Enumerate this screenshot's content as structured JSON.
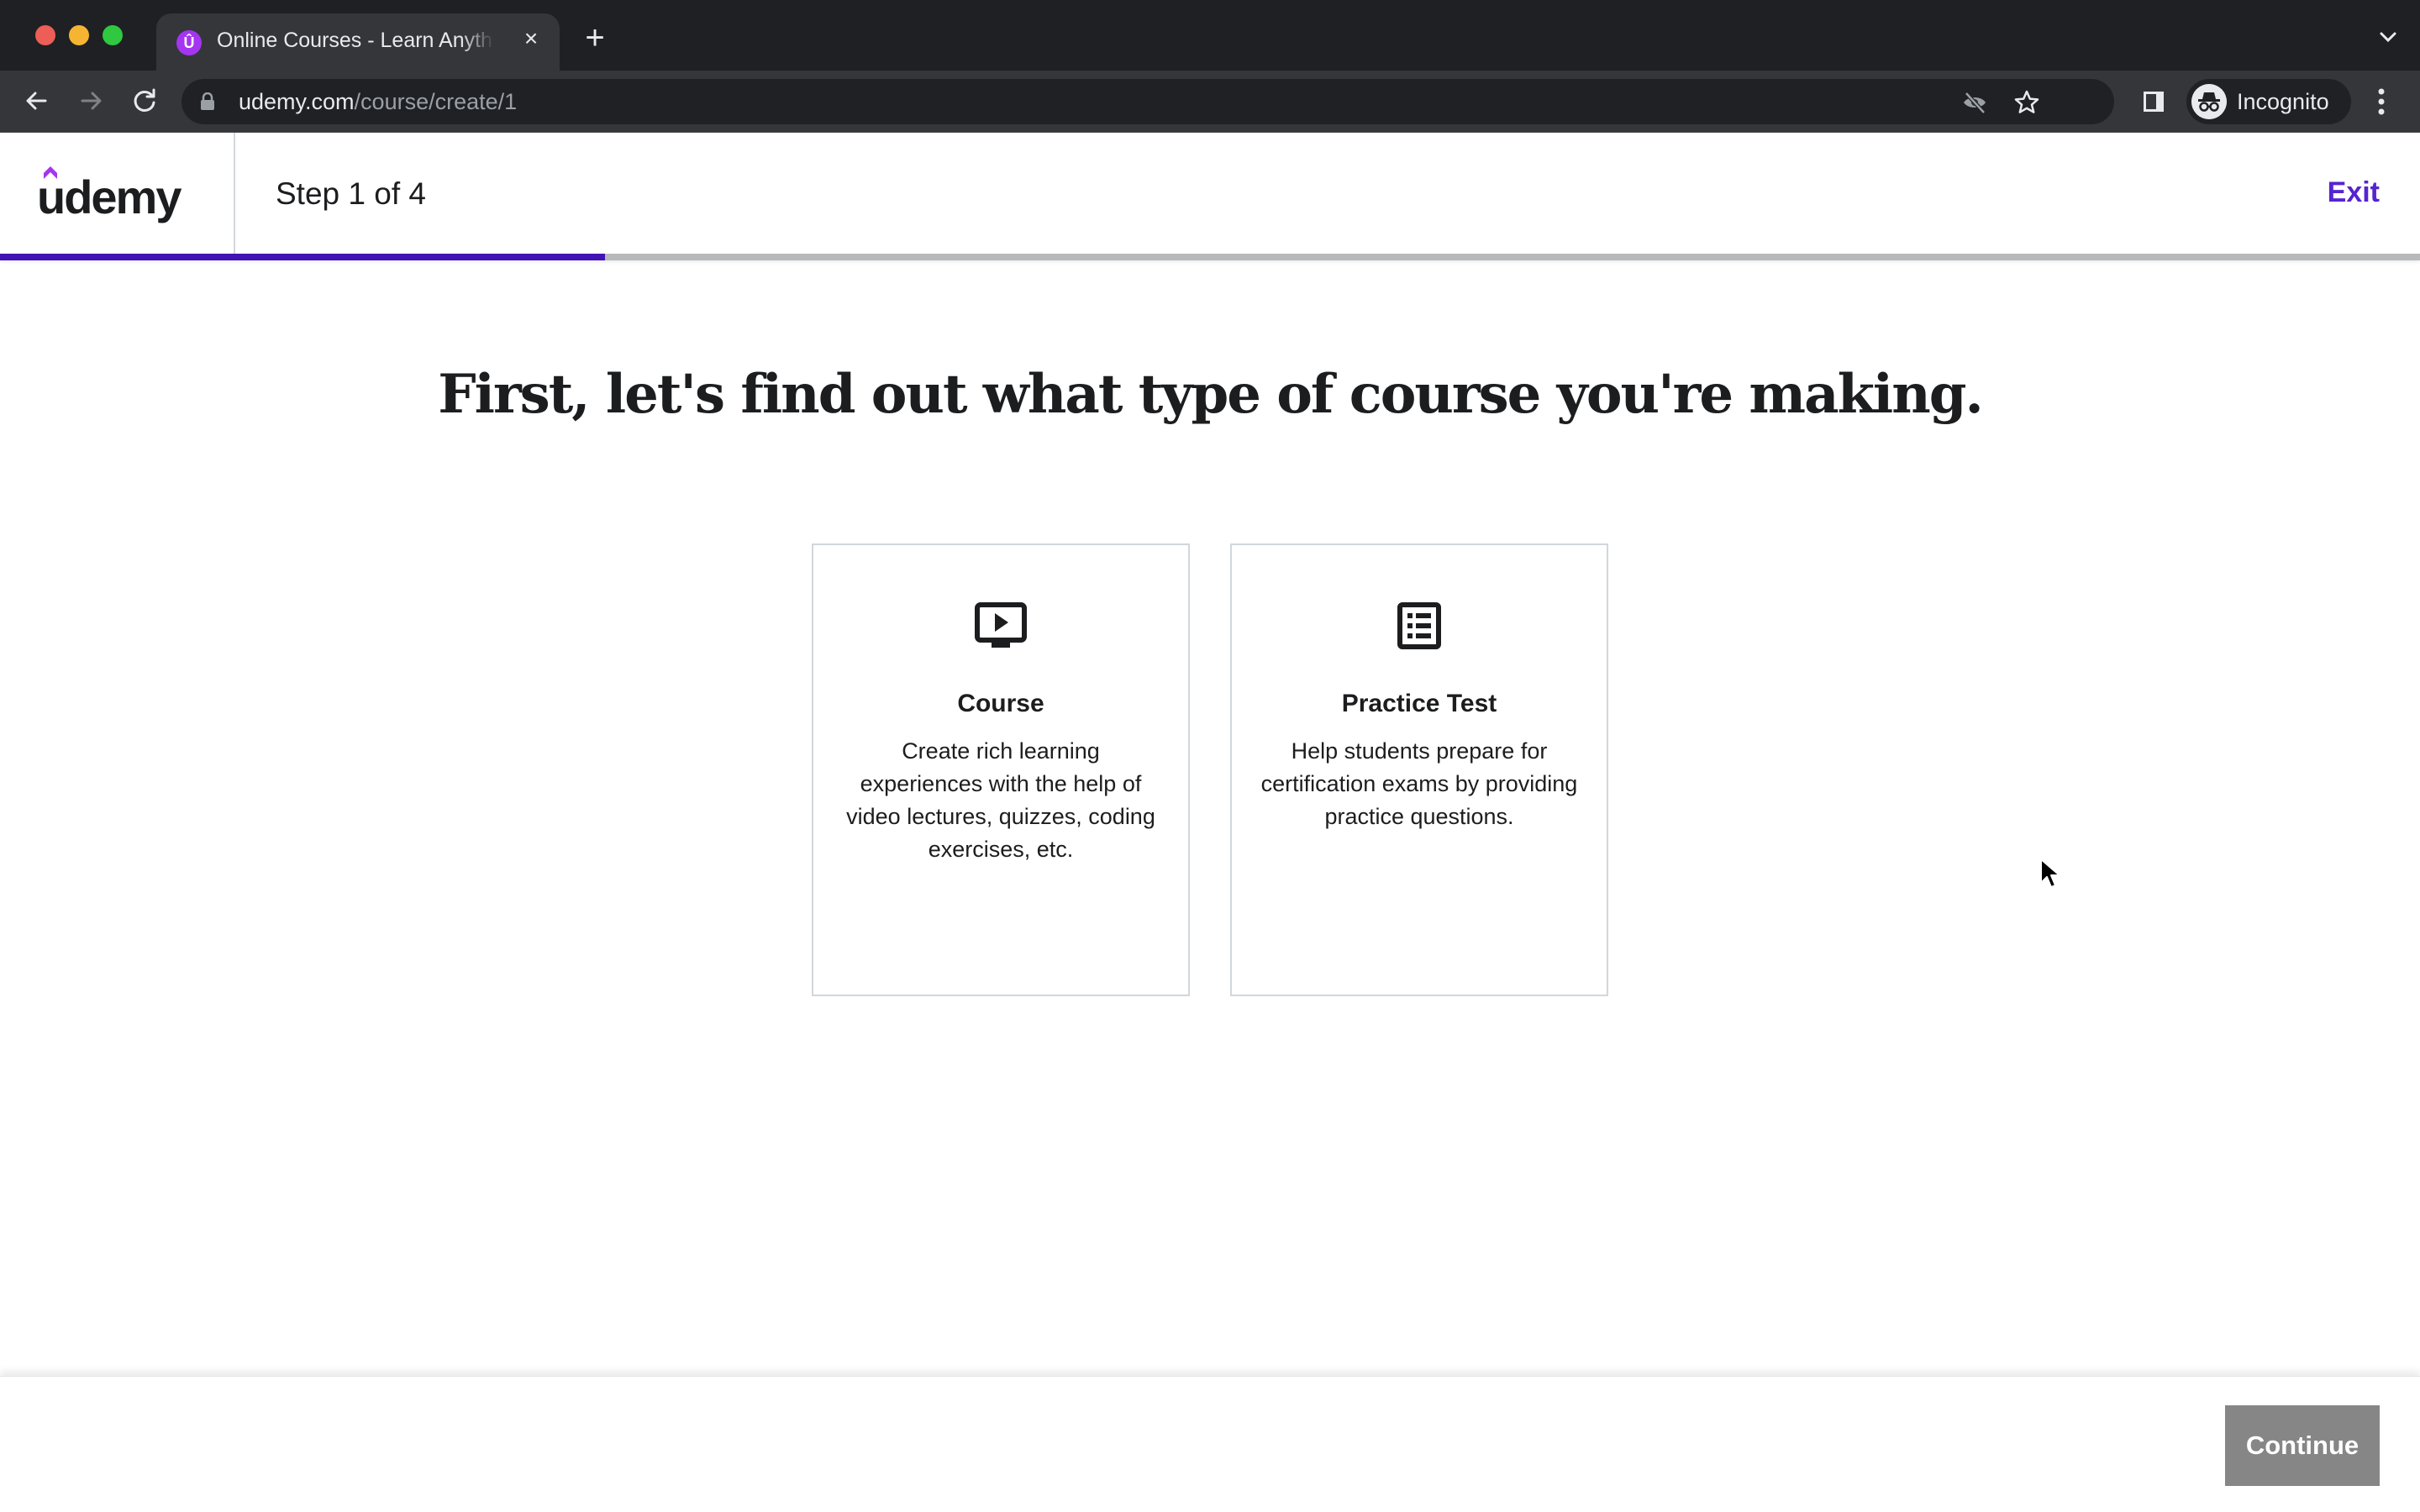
{
  "browser": {
    "tab_title": "Online Courses - Learn Anything, On Your Schedule | Udemy",
    "tab_close": "×",
    "new_tab": "+",
    "url_domain": "udemy.com",
    "url_path": "/course/create/1",
    "profile_label": "Incognito"
  },
  "header": {
    "logo_text": "udemy",
    "step_label": "Step 1 of 4",
    "exit_label": "Exit",
    "progress_percent": 25
  },
  "main": {
    "heading": "First, let's find out what type of course you're making.",
    "options": [
      {
        "icon": "video-lecture-icon",
        "title": "Course",
        "description": "Create rich learning experiences with the help of video lectures, quizzes, coding exercises, etc."
      },
      {
        "icon": "list-icon",
        "title": "Practice Test",
        "description": "Help students prepare for certification exams by providing practice questions."
      }
    ]
  },
  "footer": {
    "continue_label": "Continue"
  },
  "colors": {
    "brand_purple": "#5624d0",
    "progress_fill": "#4212b4",
    "logo_accent": "#a435f0",
    "continue_disabled": "#868686"
  }
}
